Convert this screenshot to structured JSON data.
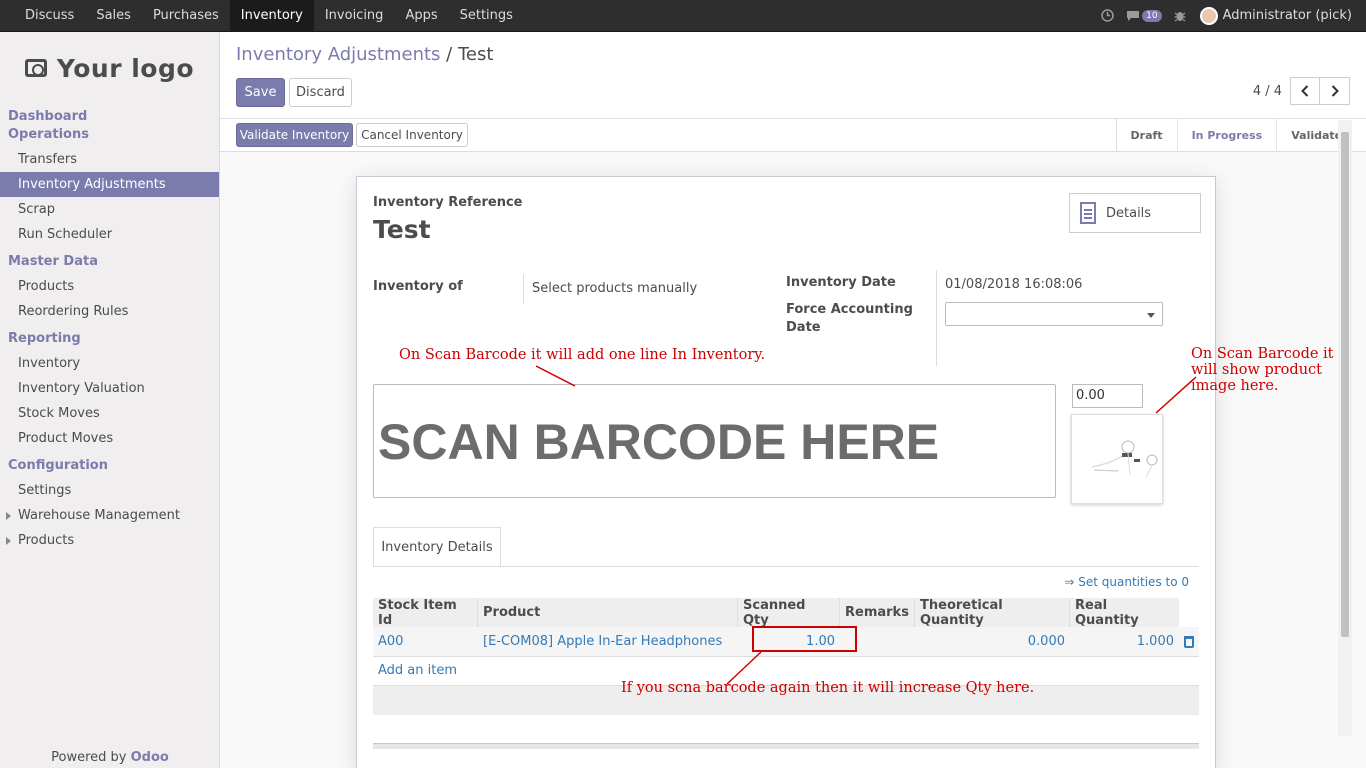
{
  "topbar": {
    "menu": [
      "Discuss",
      "Sales",
      "Purchases",
      "Inventory",
      "Invoicing",
      "Apps",
      "Settings"
    ],
    "active": "Inventory",
    "chat_count": "10",
    "user": "Administrator (pick)"
  },
  "sidebar": {
    "logo_text": "Your logo",
    "sections": {
      "dashboard": "Dashboard",
      "operations": "Operations",
      "master_data": "Master Data",
      "reporting": "Reporting",
      "configuration": "Configuration"
    },
    "operations_items": [
      "Transfers",
      "Inventory Adjustments",
      "Scrap",
      "Run Scheduler"
    ],
    "master_items": [
      "Products",
      "Reordering Rules"
    ],
    "reporting_items": [
      "Inventory",
      "Inventory Valuation",
      "Stock Moves",
      "Product Moves"
    ],
    "config_items": [
      "Settings",
      "Warehouse Management",
      "Products"
    ],
    "powered_prefix": "Powered by ",
    "powered_brand": "Odoo"
  },
  "control": {
    "breadcrumb_parent": "Inventory Adjustments",
    "breadcrumb_sep": "/",
    "breadcrumb_current": "Test",
    "save": "Save",
    "discard": "Discard",
    "pager": "4 / 4",
    "validate": "Validate Inventory",
    "cancel": "Cancel Inventory",
    "states": [
      "Draft",
      "In Progress",
      "Validated"
    ],
    "current_state": "In Progress"
  },
  "form": {
    "ref_label": "Inventory Reference",
    "ref_value": "Test",
    "details": "Details",
    "inventory_of_label": "Inventory of",
    "inventory_of_value": "Select products manually",
    "date_label": "Inventory Date",
    "date_value": "01/08/2018 16:08:06",
    "force_label_1": "Force Accounting",
    "force_label_2": "Date",
    "scan_text": "SCAN BARCODE HERE",
    "qty_value": "0.00",
    "tab": "Inventory Details",
    "set_quantities": "⇒ Set quantities to 0",
    "columns": [
      "Stock Item Id",
      "Product",
      "Scanned Qty",
      "Remarks",
      "Theoretical Quantity",
      "Real Quantity"
    ],
    "row": {
      "stock_item": "A00",
      "product": "[E-COM08] Apple In-Ear Headphones",
      "scanned": "1.00",
      "remarks": "",
      "theoretical": "0.000",
      "real": "1.000"
    },
    "add_item": "Add an item"
  },
  "annotations": {
    "a1": "On Scan Barcode it will add one line In Inventory.",
    "a2_1": "On Scan Barcode it",
    "a2_2": "will show product",
    "a2_3": "image here.",
    "a3": "If you scna barcode again then it will increase Qty here."
  },
  "colors": {
    "brand": "#7c7bad",
    "topbar": "#2e2e2e",
    "annotation": "#cc0000",
    "link": "#337ab7"
  }
}
